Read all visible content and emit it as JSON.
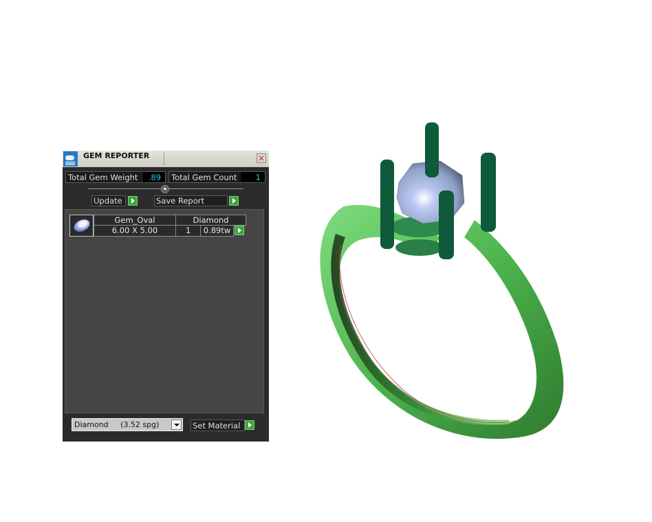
{
  "panel": {
    "title": "GEM REPORTER",
    "close_icon": "×",
    "total_gem_weight_label": "Total Gem Weight",
    "total_gem_weight_value": ".89",
    "total_gem_count_label": "Total Gem Count",
    "total_gem_count_value": "1",
    "update_label": "Update",
    "save_report_label": "Save Report",
    "gems": [
      {
        "shape": "Gem_Oval",
        "material": "Diamond",
        "size": "6.00 X 5.00",
        "count": "1",
        "weight": "0.89tw"
      }
    ],
    "material_select_value": "Diamond     (3.52 spg)",
    "set_material_label": "Set Material"
  },
  "viewport": {
    "object": "ring-model",
    "band_color": "#5cc35c",
    "prong_color": "#0f5a3a",
    "gem_color": "#a6b8e6"
  }
}
